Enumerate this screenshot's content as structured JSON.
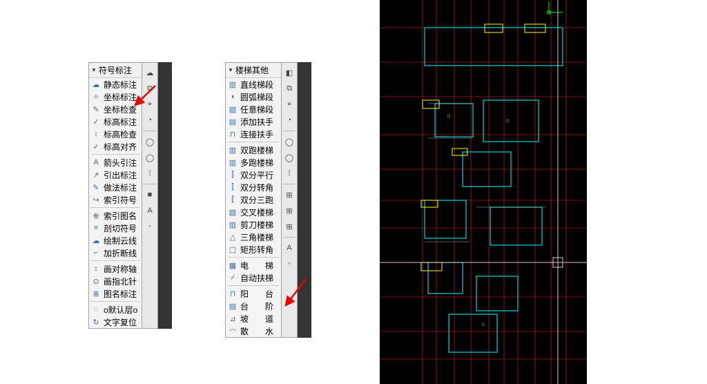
{
  "panel1": {
    "header": "符号标注",
    "groups": [
      [
        "静态标注",
        "坐标标注",
        "坐标检查",
        "标高标注",
        "标高检查",
        "标高对齐"
      ],
      [
        "箭头引注",
        "引出标注",
        "做法标注",
        "索引符号"
      ],
      [
        "索引图名",
        "剖切符号",
        "绘制云线",
        "加折断线"
      ],
      [
        "画对称轴",
        "画指北针",
        "图名标注"
      ],
      [
        "o默认层o",
        "文字复位"
      ]
    ],
    "side": [
      "☁",
      "⧉",
      "⌖",
      "◔",
      "–",
      "◯",
      "◯",
      "⁞",
      "–",
      "■",
      "A",
      "◦"
    ]
  },
  "panel2": {
    "header": "楼梯其他",
    "groups": [
      [
        "直线梯段",
        "圆弧梯段",
        "任意梯段",
        "添加扶手",
        "连接扶手"
      ],
      [
        "双跑楼梯",
        "多跑楼梯",
        "双分平行",
        "双分转角",
        "双分三跑",
        "交叉楼梯",
        "剪刀楼梯",
        "三角楼梯",
        "矩形转角"
      ],
      [
        "电　　梯",
        "自动扶梯"
      ],
      [
        "阳　　台",
        "台　　阶",
        "坡　　道",
        "散　　水"
      ]
    ],
    "side": [
      "◧",
      "⧉",
      "⌖",
      "◔",
      "–",
      "◯",
      "◯",
      "⁞",
      "–",
      "⊞",
      "⊞",
      "⊞",
      "–",
      "A",
      "◦"
    ]
  },
  "icons1": [
    [
      "☁",
      "✧",
      "✎",
      "✓",
      "↕",
      "✓",
      "≋"
    ],
    [
      "A",
      "↗",
      "✎",
      "↪"
    ],
    [
      "⊕",
      "≡",
      "☁",
      "⌐"
    ],
    [
      "↕",
      "⊙",
      "≣"
    ],
    [
      "◌",
      "↻"
    ]
  ],
  "icons2": [
    [
      "▥",
      "◖",
      "▨",
      "▤",
      "⊓"
    ],
    [
      "▥",
      "▥",
      "⫿",
      "⫿",
      "⫿",
      "▧",
      "▥",
      "△",
      "▢"
    ],
    [
      "▦",
      "⌿"
    ],
    [
      "⊓",
      "▤",
      "⊿",
      "◠"
    ]
  ]
}
